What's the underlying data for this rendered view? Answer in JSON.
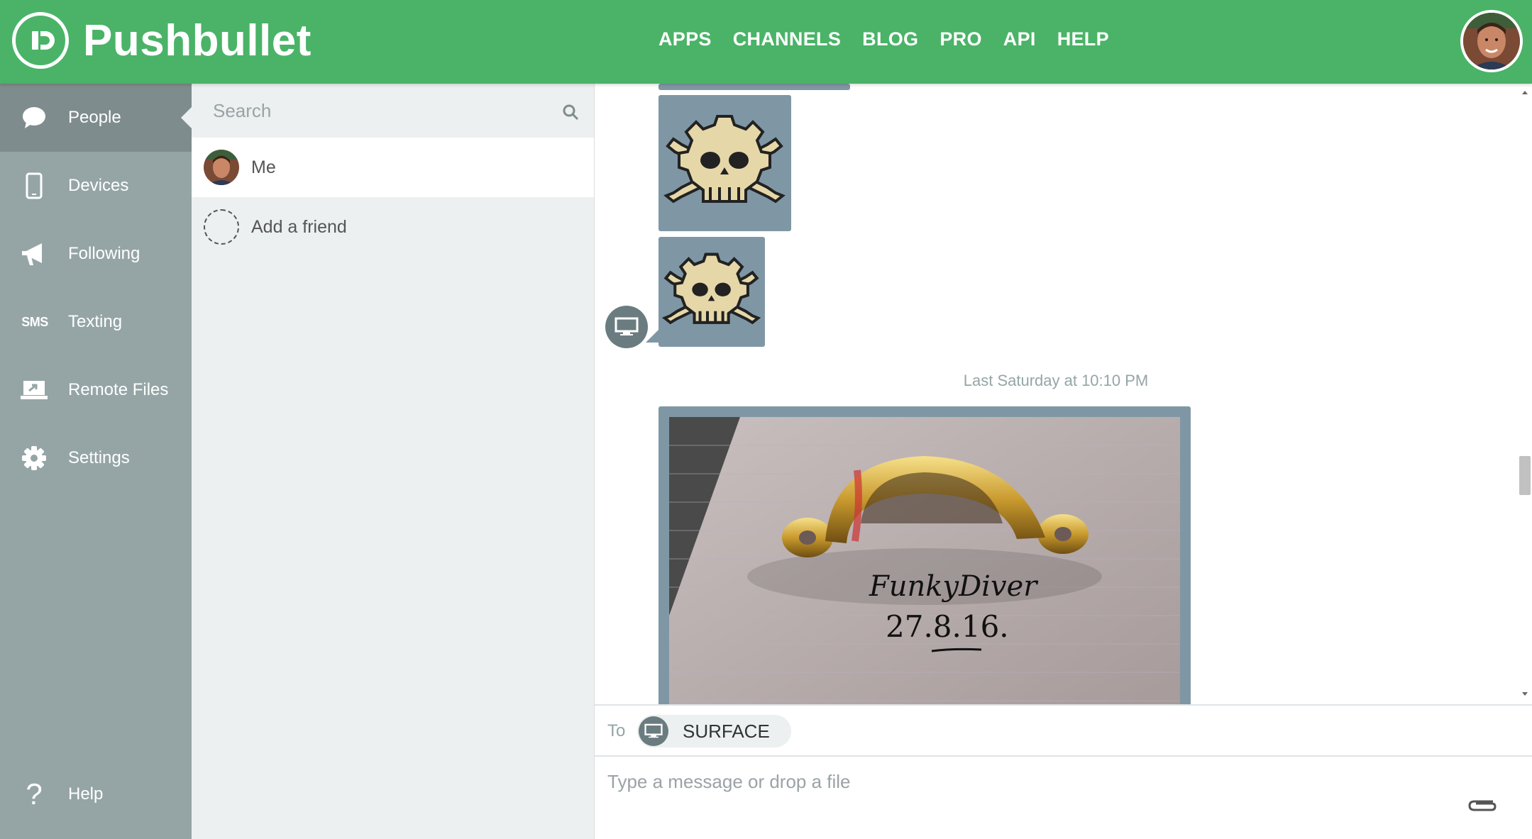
{
  "header": {
    "brand": "Pushbullet",
    "nav": [
      "APPS",
      "CHANNELS",
      "BLOG",
      "PRO",
      "API",
      "HELP"
    ],
    "color": "#4ab367"
  },
  "sidebar": {
    "items": [
      {
        "label": "People",
        "icon": "speech-bubble-icon",
        "active": true
      },
      {
        "label": "Devices",
        "icon": "phone-icon"
      },
      {
        "label": "Following",
        "icon": "megaphone-icon"
      },
      {
        "label": "Texting",
        "icon": "sms-icon",
        "icon_text": "SMS"
      },
      {
        "label": "Remote Files",
        "icon": "laptop-icon"
      },
      {
        "label": "Settings",
        "icon": "gear-icon"
      }
    ],
    "help": {
      "label": "Help",
      "icon": "question-icon"
    }
  },
  "contacts": {
    "search_placeholder": "Search",
    "items": [
      {
        "label": "Me"
      },
      {
        "label": "Add a friend"
      }
    ]
  },
  "thread": {
    "timestamp": "Last Saturday at 10:10 PM",
    "photo_handwriting_line1": "FunkyDiver",
    "photo_handwriting_line2": "27.8.16."
  },
  "compose": {
    "to_label": "To",
    "target_device": "SURFACE",
    "placeholder": "Type a message or drop a file"
  }
}
